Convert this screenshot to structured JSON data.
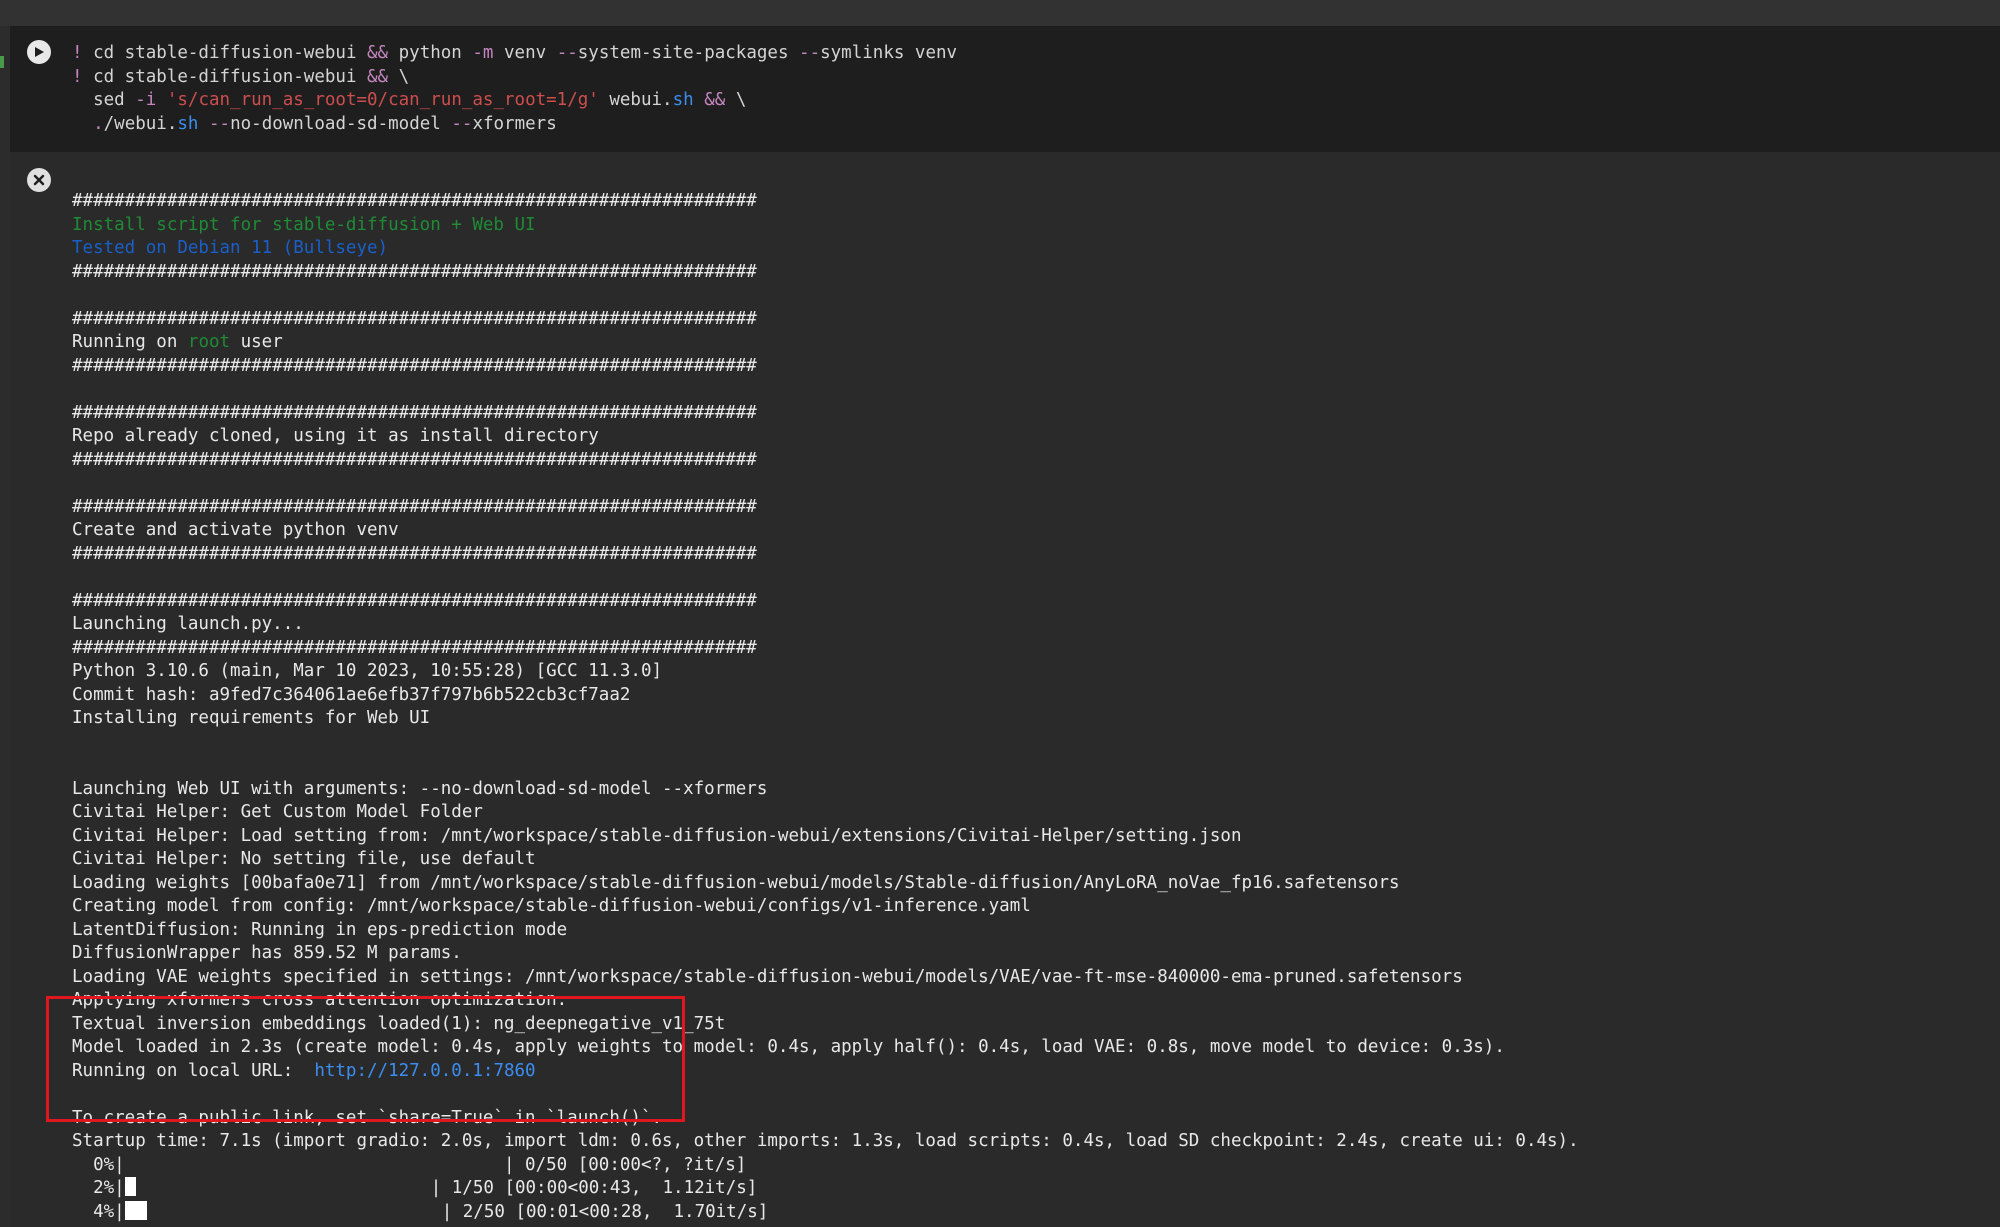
{
  "input_cell": {
    "run_icon": "play-icon",
    "lines": [
      [
        "! ",
        "cd stable-diffusion-webui ",
        "&&",
        " python ",
        "-m",
        " venv ",
        "--",
        "system-site-packages ",
        "--",
        "symlinks venv"
      ],
      [
        "! ",
        "cd stable-diffusion-webui ",
        "&&",
        " \\"
      ],
      [
        "  sed ",
        "-i",
        " ",
        "'s/can_run_as_root=0/can_run_as_root=1/g'",
        " webui.",
        "sh",
        " ",
        "&&",
        " \\"
      ],
      [
        "  ",
        ".",
        "/webui.",
        "sh",
        " ",
        "--",
        "no-download-sd-model ",
        "--",
        "xformers"
      ]
    ]
  },
  "output_cell": {
    "clear_icon": "close-circle-icon",
    "lines": [
      "#################################################################",
      "Install script for stable-diffusion + Web UI",
      "Tested on Debian 11 (Bullseye)",
      "#################################################################",
      "",
      "#################################################################",
      "Running on ",
      "root",
      " user",
      "#################################################################",
      "",
      "#################################################################",
      "Repo already cloned, using it as install directory",
      "#################################################################",
      "",
      "#################################################################",
      "Create and activate python venv",
      "#################################################################",
      "",
      "#################################################################",
      "Launching launch.py...",
      "#################################################################",
      "Python 3.10.6 (main, Mar 10 2023, 10:55:28) [GCC 11.3.0]",
      "Commit hash: a9fed7c364061ae6efb37f797b6b522cb3cf7aa2",
      "Installing requirements for Web UI",
      "",
      "",
      "Launching Web UI with arguments: --no-download-sd-model --xformers",
      "Civitai Helper: Get Custom Model Folder",
      "Civitai Helper: Load setting from: /mnt/workspace/stable-diffusion-webui/extensions/Civitai-Helper/setting.json",
      "Civitai Helper: No setting file, use default",
      "Loading weights [00bafa0e71] from /mnt/workspace/stable-diffusion-webui/models/Stable-diffusion/AnyLoRA_noVae_fp16.safetensors",
      "Creating model from config: /mnt/workspace/stable-diffusion-webui/configs/v1-inference.yaml",
      "LatentDiffusion: Running in eps-prediction mode",
      "DiffusionWrapper has 859.52 M params.",
      "Loading VAE weights specified in settings: /mnt/workspace/stable-diffusion-webui/models/VAE/vae-ft-mse-840000-ema-pruned.safetensors",
      "Applying xformers cross attention optimization.",
      "Textual inversion embeddings loaded(1): ng_deepnegative_v1_75t",
      "Model loaded in 2.3s (create model: 0.4s, apply weights to model: 0.4s, apply half(): 0.4s, load VAE: 0.8s, move model to device: 0.3s).",
      "Running on local URL:  ",
      "http://127.0.0.1:7860",
      "",
      "To create a public link, set `share=True` in `launch()`.",
      "Startup time: 7.1s (import gradio: 2.0s, import ldm: 0.6s, other imports: 1.3s, load scripts: 0.4s, load SD checkpoint: 2.4s, create ui: 0.4s).",
      "  0%|",
      "| 0/50 [00:00<?, ?it/s]",
      "  2%|",
      "| 1/50 [00:00<00:43,  1.12it/s]",
      "  4%|",
      "| 2/50 [00:01<00:28,  1.70it/s]"
    ],
    "progress": [
      {
        "fraction": 0.0
      },
      {
        "fraction": 0.02
      },
      {
        "fraction": 0.04
      }
    ]
  },
  "colors": {
    "accent_red_box": "#e0171f",
    "green_text": "#1f8b35",
    "blue_text": "#1a5fc9",
    "link": "#3b8ef0"
  }
}
